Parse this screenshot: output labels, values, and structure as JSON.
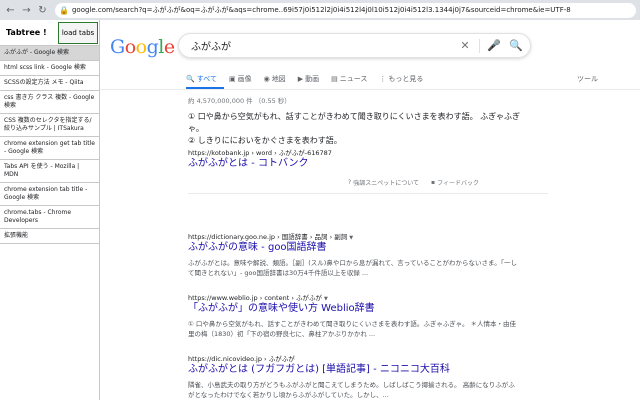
{
  "browser": {
    "url": "google.com/search?q=ふがふが&oq=ふがふが&aqs=chrome..69i57j0i512l2j0i4i512l4j0l10i512j0i4i512l3.1344j0j7&sourceid=chrome&ie=UTF-8"
  },
  "sidebar": {
    "title": "Tabtree !",
    "load_tabs_label": "load tabs",
    "items": [
      {
        "label": "ふがふが - Google 検索"
      },
      {
        "label": "html scss link - Google 検索"
      },
      {
        "label": "SCSSの設定方法 メモ - Qiita"
      },
      {
        "label": "css 書き方 クラス 複数 - Google 検索"
      },
      {
        "label": "CSS 複数のセレクタを指定する/絞り込みサンプル | ITSakura"
      },
      {
        "label": "chrome extension get tab title - Google 検索"
      },
      {
        "label": "Tabs API を使う - Mozilla | MDN"
      },
      {
        "label": "chrome extension tab title - Google 検索"
      },
      {
        "label": "chrome.tabs - Chrome Developers"
      },
      {
        "label": "拡張機能"
      }
    ]
  },
  "search": {
    "query": "ふがふが",
    "tabs": [
      {
        "label": "すべて"
      },
      {
        "label": "画像"
      },
      {
        "label": "地図"
      },
      {
        "label": "動画"
      },
      {
        "label": "ニュース"
      },
      {
        "label": "もっと見る"
      }
    ],
    "tools_label": "ツール",
    "stats": "約 4,570,000,000 件 （0.55 秒）"
  },
  "featured": {
    "line1": "① 口や鼻から空気がもれ、話すことがきわめて聞き取りにくいさまを表わす語。 ふぎゃふぎゃ。",
    "line2": "② しきりににおいをかぐさまを表わす語。",
    "url": "https://kotobank.jp › word › ふがふが-616787",
    "title": "ふがふがとは - コトバンク",
    "about_label": "強調スニペットについて",
    "feedback_label": "フィードバック"
  },
  "results": [
    {
      "url": "https://dictionary.goo.ne.jp › 国語辞書 › 品詞 › 副詞",
      "title": "ふがふがの意味 - goo国語辞書",
      "desc": "ふがふがとは。意味や解説、類語。［副］(スル)鼻や口から息が漏れて、言っていることがわからないさま。「一して聞きとれない」- goo国語辞書は30万4千件語以上を収録 ..."
    },
    {
      "url": "https://www.weblio.jp › content › ふがふが",
      "title": "「ふがふが」の意味や使い方 Weblio辞書",
      "desc": "① 口や鼻から空気がもれ、話すことがきわめて聞き取りにくいさまを表わす語。ふぎゃふぎゃ。 ＊人情本・由佳里の梅（1830）初「下の宿の野良七に、鼻柱アかぶりかかれ ..."
    },
    {
      "url": "https://dic.nicovideo.jp › ふがふが",
      "title": "ふがふがとは (フガフガとは) [単語記事] - ニコニコ大百科",
      "desc": "隣雀、小島武夫の取り方がどうもふがふがと聞こえてしまうため。しばしばこう揶揄される。 高齢になりふがふがとなったわけでなく若かりし頃からふがふがしていた。しかし、..."
    }
  ],
  "colors": {
    "link": "#1a0dab",
    "accent": "#1a73e8",
    "sidebar_active": "#d6d6d6",
    "load_tabs_border": "#2c7a2c"
  }
}
